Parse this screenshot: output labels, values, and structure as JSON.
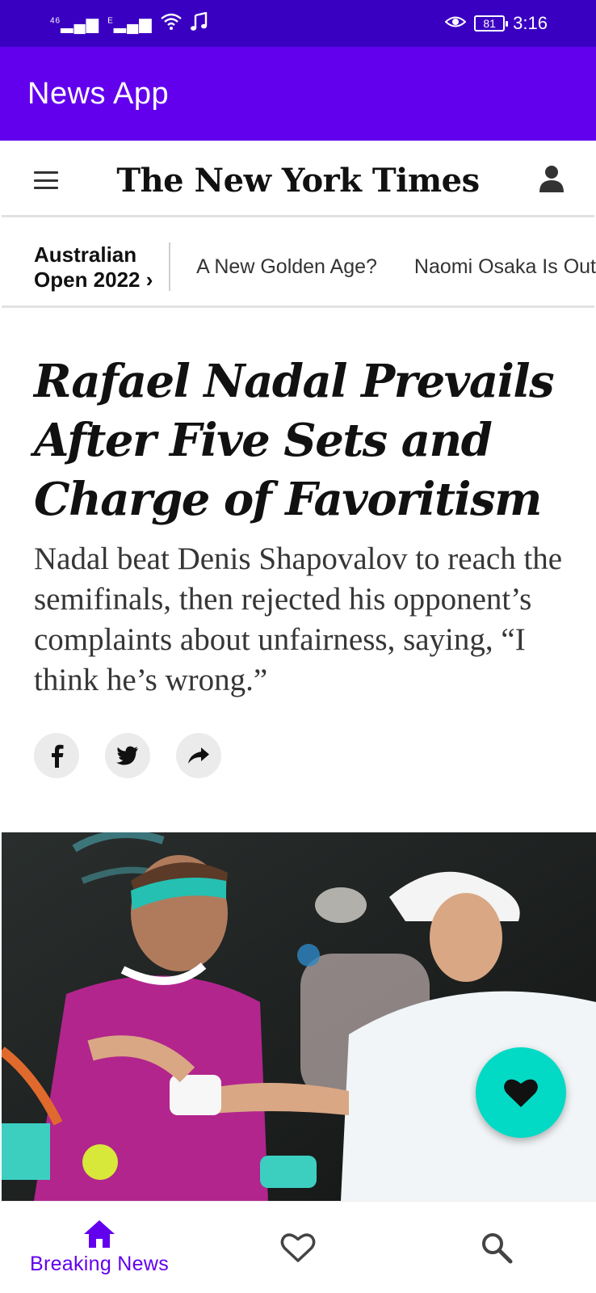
{
  "status_bar": {
    "signal_1": "46",
    "signal_2": "E",
    "battery": "81",
    "time": "3:16",
    "icons": [
      "signal-icon",
      "signal-icon",
      "wifi-icon",
      "music-icon",
      "eye-icon",
      "battery-icon"
    ]
  },
  "app_bar": {
    "title": "News App"
  },
  "nyt": {
    "masthead": "The New York Times",
    "section": {
      "line1": "Australian",
      "line2": "Open 2022 ›"
    },
    "topics": [
      "A New Golden Age?",
      "Naomi Osaka Is Out"
    ]
  },
  "article": {
    "headline": "Rafael Nadal Prevails After Five Sets and Charge of Favoritism",
    "summary": "Nadal beat Denis Shapovalov to reach the semifinals, then rejected his opponent’s complaints about unfairness, saying, “I think he’s wrong.”",
    "share": [
      "facebook-icon",
      "twitter-icon",
      "share-icon"
    ]
  },
  "bottom_nav": {
    "items": [
      {
        "label": "Breaking News",
        "icon": "home-icon",
        "active": true
      },
      {
        "label": "",
        "icon": "heart-outline-icon",
        "active": false
      },
      {
        "label": "",
        "icon": "search-icon",
        "active": false
      }
    ]
  },
  "colors": {
    "status_bar": "#3a00c2",
    "app_bar": "#6200ee",
    "fab": "#03dac5",
    "nav_active": "#6200ee"
  }
}
